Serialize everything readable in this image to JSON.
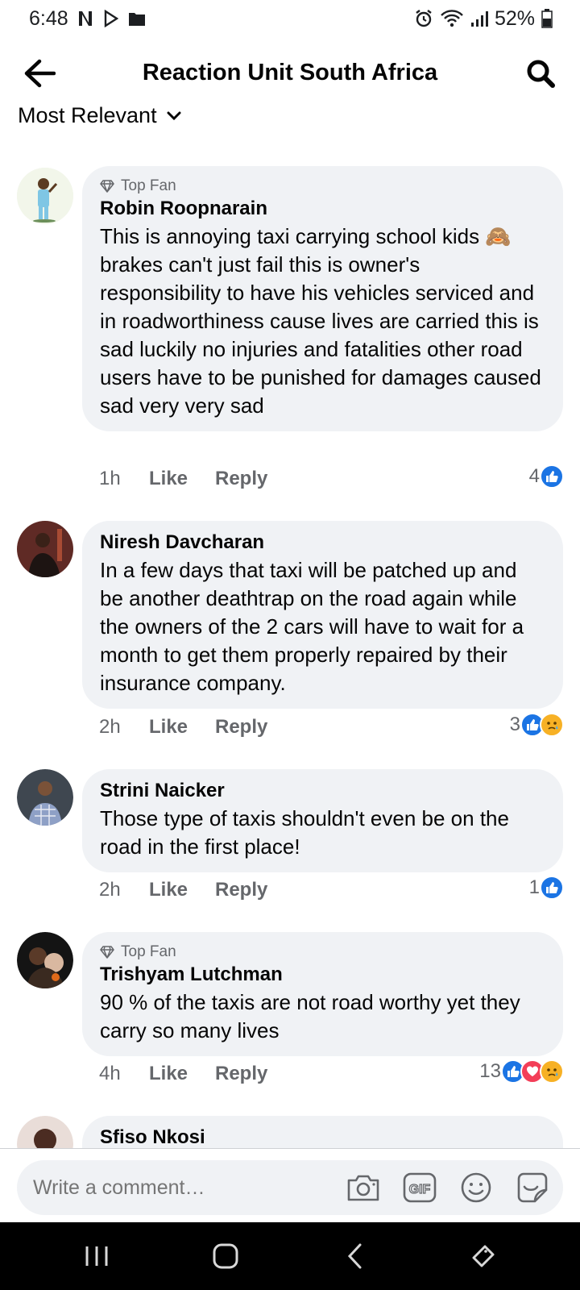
{
  "status_bar": {
    "time": "6:48",
    "battery": "52%"
  },
  "header": {
    "title": "Reaction Unit South Africa"
  },
  "sort": {
    "label": "Most Relevant"
  },
  "comments": [
    {
      "badge": "Top Fan",
      "author": "Robin Roopnarain",
      "text": "This is annoying taxi carrying school kids 🙈 brakes can't just fail this is owner's responsibility to have his vehicles serviced and in roadworthiness cause lives are carried this is sad luckily no injuries and fatalities other road users have to be punished for damages caused sad very very sad",
      "time": "1h",
      "like_label": "Like",
      "reply_label": "Reply",
      "reaction_count": "4",
      "reactions": [
        "like"
      ]
    },
    {
      "badge": "",
      "author": "Niresh Davcharan",
      "text": "In a few days that taxi will be patched up and be another deathtrap on the road again while the owners of the 2 cars will have to wait for a month to get them properly repaired by their insurance company.",
      "time": "2h",
      "like_label": "Like",
      "reply_label": "Reply",
      "reaction_count": "3",
      "reactions": [
        "like",
        "sad"
      ]
    },
    {
      "badge": "",
      "author": "Strini Naicker",
      "text": "Those type of taxis shouldn't even be on the road in the first place!",
      "time": "2h",
      "like_label": "Like",
      "reply_label": "Reply",
      "reaction_count": "1",
      "reactions": [
        "like"
      ]
    },
    {
      "badge": "Top Fan",
      "author": "Trishyam Lutchman",
      "text": "90 % of the taxis are not road worthy yet they carry so many lives",
      "time": "4h",
      "like_label": "Like",
      "reply_label": "Reply",
      "reaction_count": "13",
      "reactions": [
        "like",
        "love",
        "sad"
      ]
    },
    {
      "badge": "",
      "author": "Sfiso Nkosi",
      "text": "",
      "time": "",
      "like_label": "",
      "reply_label": "",
      "reaction_count": "",
      "reactions": []
    }
  ],
  "composer": {
    "placeholder": "Write a comment…"
  },
  "colors": {
    "bubble": "#f0f2f5",
    "like": "#1b74e4",
    "love": "#f33e58",
    "sad": "#f7b125",
    "secondary_text": "#65676b"
  },
  "icons": {
    "back": "arrow-left-icon",
    "search": "search-icon",
    "sort": "chevron-down-icon",
    "camera": "camera-icon",
    "gif": "gif-icon",
    "emoji": "emoji-icon",
    "sticker": "sticker-icon"
  }
}
